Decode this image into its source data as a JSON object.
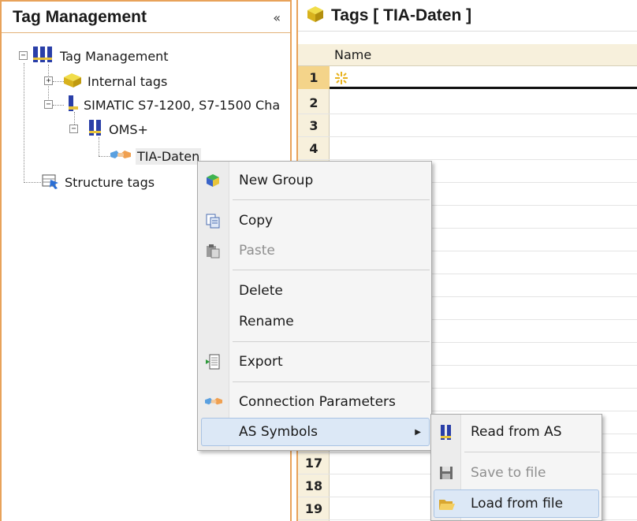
{
  "left_panel": {
    "title": "Tag Management",
    "collapse_glyph": "«",
    "tree": {
      "root": "Tag Management",
      "internal_tags": "Internal tags",
      "plc": "SIMATIC S7-1200, S7-1500 Cha",
      "oms": "OMS+",
      "tia": "TIA-Daten",
      "structure_tags": "Structure tags"
    }
  },
  "right_panel": {
    "title": "Tags [ TIA-Daten ]",
    "column_name": "Name",
    "rows_top": [
      "1",
      "2",
      "3",
      "4"
    ],
    "rows_bottom": [
      "17",
      "18",
      "19"
    ]
  },
  "context_menu": {
    "new_group": "New Group",
    "copy": "Copy",
    "paste": "Paste",
    "delete": "Delete",
    "rename": "Rename",
    "export": "Export",
    "connection_parameters": "Connection Parameters",
    "as_symbols": "AS Symbols",
    "submenu_arrow": "▶"
  },
  "submenu": {
    "read_from_as": "Read from AS",
    "save_to_file": "Save to file",
    "load_from_file": "Load from file"
  },
  "colors": {
    "panel_border": "#e8a25a",
    "grid_header": "#f7f0dc",
    "selected_row_num": "#f4d48a",
    "menu_hover": "#dce8f6",
    "disabled_text": "#8f8f8f"
  }
}
